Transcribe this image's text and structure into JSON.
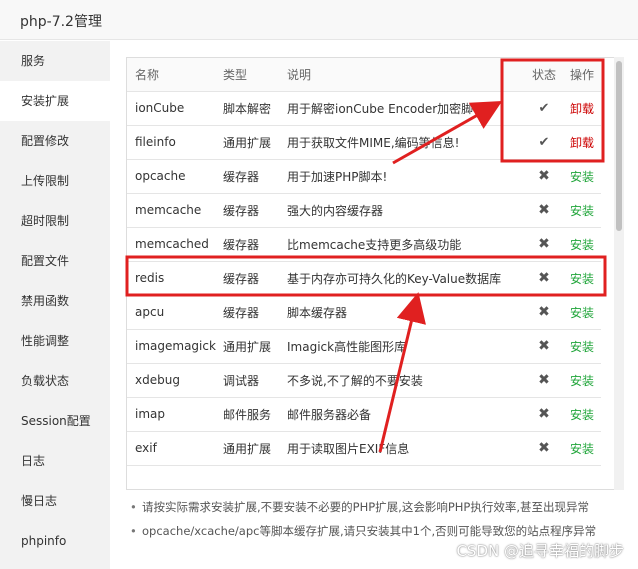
{
  "window": {
    "title": "php-7.2管理"
  },
  "sidebar": {
    "items": [
      {
        "label": "服务"
      },
      {
        "label": "安装扩展"
      },
      {
        "label": "配置修改"
      },
      {
        "label": "上传限制"
      },
      {
        "label": "超时限制"
      },
      {
        "label": "配置文件"
      },
      {
        "label": "禁用函数"
      },
      {
        "label": "性能调整"
      },
      {
        "label": "负载状态"
      },
      {
        "label": "Session配置"
      },
      {
        "label": "日志"
      },
      {
        "label": "慢日志"
      },
      {
        "label": "phpinfo"
      }
    ]
  },
  "table": {
    "headers": {
      "name": "名称",
      "type": "类型",
      "desc": "说明",
      "status": "状态",
      "op": "操作"
    },
    "rows": [
      {
        "name": "ionCube",
        "type": "脚本解密",
        "desc": "用于解密ionCube Encoder加密脚本!",
        "status": "✔",
        "op": "卸载"
      },
      {
        "name": "fileinfo",
        "type": "通用扩展",
        "desc": "用于获取文件MIME,编码等信息!",
        "status": "✔",
        "op": "卸载"
      },
      {
        "name": "opcache",
        "type": "缓存器",
        "desc": "用于加速PHP脚本!",
        "status": "✖",
        "op": "安装"
      },
      {
        "name": "memcache",
        "type": "缓存器",
        "desc": "强大的内容缓存器",
        "status": "✖",
        "op": "安装"
      },
      {
        "name": "memcached",
        "type": "缓存器",
        "desc": "比memcache支持更多高级功能",
        "status": "✖",
        "op": "安装"
      },
      {
        "name": "redis",
        "type": "缓存器",
        "desc": "基于内存亦可持久化的Key-Value数据库",
        "status": "✖",
        "op": "安装"
      },
      {
        "name": "apcu",
        "type": "缓存器",
        "desc": "脚本缓存器",
        "status": "✖",
        "op": "安装"
      },
      {
        "name": "imagemagick",
        "type": "通用扩展",
        "desc": "Imagick高性能图形库",
        "status": "✖",
        "op": "安装"
      },
      {
        "name": "xdebug",
        "type": "调试器",
        "desc": "不多说,不了解的不要安装",
        "status": "✖",
        "op": "安装"
      },
      {
        "name": "imap",
        "type": "邮件服务",
        "desc": "邮件服务器必备",
        "status": "✖",
        "op": "安装"
      },
      {
        "name": "exif",
        "type": "通用扩展",
        "desc": "用于读取图片EXIF信息",
        "status": "✖",
        "op": "安装"
      }
    ]
  },
  "notes": [
    "请按实际需求安装扩展,不要安装不必要的PHP扩展,这会影响PHP执行效率,甚至出现异常",
    "opcache/xcache/apc等脚本缓存扩展,请只安装其中1个,否则可能导致您的站点程序异常"
  ],
  "watermark": "CSDN @追寻幸福的脚步",
  "colors": {
    "install": "#20a53a",
    "uninstall": "#cc0000",
    "annotation": "#e02020"
  }
}
